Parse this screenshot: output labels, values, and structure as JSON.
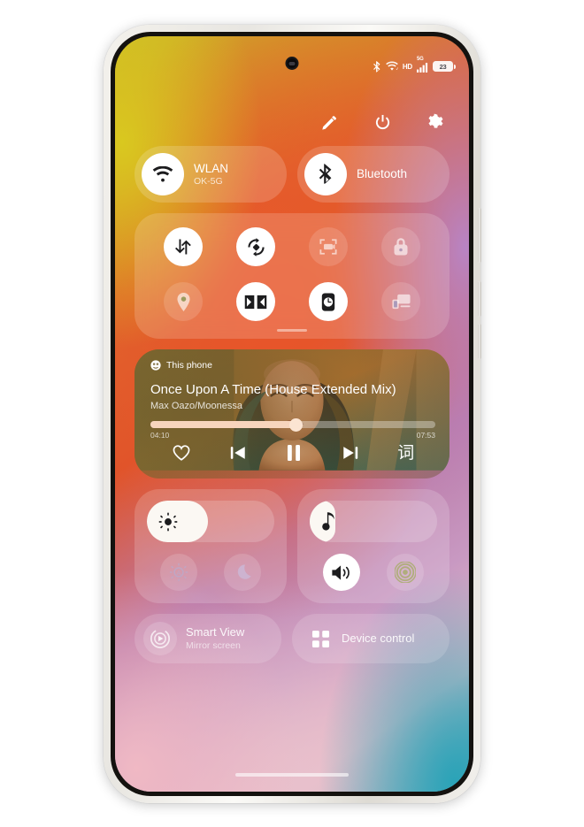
{
  "status_bar": {
    "bluetooth_icon": "bluetooth-icon",
    "wifi_icon": "wifi-icon",
    "hd_label": "HD",
    "signal_label": "5G",
    "signal_icon": "signal-bars-icon",
    "battery_percent": "23",
    "battery_icon": "battery-icon"
  },
  "action_row": {
    "edit_label": "edit-panel",
    "edit_icon": "pencil-icon",
    "power_label": "power-menu",
    "power_icon": "power-icon",
    "settings_label": "settings",
    "settings_icon": "gear-icon"
  },
  "connectivity": {
    "wlan": {
      "title": "WLAN",
      "subtitle": "OK-5G",
      "icon": "wifi-icon",
      "state": "on"
    },
    "bluetooth": {
      "title": "Bluetooth",
      "subtitle": "",
      "icon": "bluetooth-icon",
      "state": "on"
    }
  },
  "toggles": [
    {
      "name": "mobile-data",
      "icon": "data-transfer-icon",
      "state": "on"
    },
    {
      "name": "auto-rotate",
      "icon": "auto-rotate-icon",
      "state": "on"
    },
    {
      "name": "screen-record",
      "icon": "screen-record-icon",
      "state": "off"
    },
    {
      "name": "screen-lock",
      "icon": "lock-icon",
      "state": "off"
    },
    {
      "name": "location",
      "icon": "location-pin-icon",
      "state": "off"
    },
    {
      "name": "dolby-atmos",
      "icon": "dolby-icon",
      "state": "on"
    },
    {
      "name": "alarm-clock",
      "icon": "clock-icon",
      "state": "on"
    },
    {
      "name": "screen-cast",
      "icon": "cast-screen-icon",
      "state": "off"
    }
  ],
  "media": {
    "source_label": "This phone",
    "source_icon": "device-icon",
    "title": "Once Upon A Time (House Extended Mix)",
    "artist": "Max Oazo/Moonessa",
    "elapsed": "04:10",
    "duration": "07:53",
    "progress_percent": 51,
    "favorite_icon": "heart-icon",
    "previous_icon": "skip-previous-icon",
    "playpause_icon": "pause-icon",
    "next_icon": "skip-next-icon",
    "lyrics_label": "词",
    "playing": true
  },
  "brightness": {
    "icon": "brightness-icon",
    "level_percent": 48,
    "auto_brightness": {
      "icon": "auto-brightness-icon",
      "state": "off"
    },
    "dark_mode": {
      "icon": "moon-icon",
      "state": "off"
    }
  },
  "volume": {
    "icon": "music-note-icon",
    "level_percent": 20,
    "speaker": {
      "icon": "speaker-icon",
      "state": "on"
    },
    "vibrate": {
      "icon": "vibrate-rings-icon",
      "state": "off"
    }
  },
  "bottom_tiles": {
    "smart_view": {
      "title": "Smart View",
      "subtitle": "Mirror screen",
      "icon": "smart-view-icon"
    },
    "device_control": {
      "title": "Device control",
      "subtitle": "",
      "icon": "grid-squares-icon"
    }
  },
  "colors": {
    "accent_progress": "#f7d5bd",
    "tile_active": "#ffffff",
    "panel_glass": "rgba(255,255,255,0.17)",
    "text_primary": "#ffffff",
    "wallpaper_yellow": "#c9bc27",
    "wallpaper_orange": "#e0542a",
    "wallpaper_purple": "#c899c2",
    "wallpaper_pink": "#edbfc9",
    "wallpaper_teal": "#56a9b6"
  }
}
